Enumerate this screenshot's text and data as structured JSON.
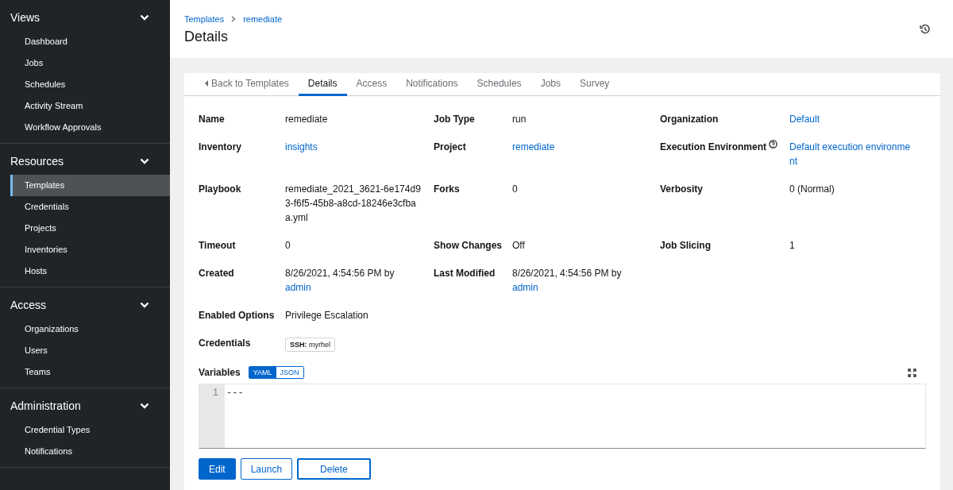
{
  "sidebar": {
    "sections": [
      {
        "title": "Views",
        "expanded": true,
        "items": [
          {
            "label": "Dashboard",
            "selected": false
          },
          {
            "label": "Jobs",
            "selected": false
          },
          {
            "label": "Schedules",
            "selected": false
          },
          {
            "label": "Activity Stream",
            "selected": false
          },
          {
            "label": "Workflow Approvals",
            "selected": false
          }
        ]
      },
      {
        "title": "Resources",
        "expanded": true,
        "items": [
          {
            "label": "Templates",
            "selected": true
          },
          {
            "label": "Credentials",
            "selected": false
          },
          {
            "label": "Projects",
            "selected": false
          },
          {
            "label": "Inventories",
            "selected": false
          },
          {
            "label": "Hosts",
            "selected": false
          }
        ]
      },
      {
        "title": "Access",
        "expanded": true,
        "items": [
          {
            "label": "Organizations",
            "selected": false
          },
          {
            "label": "Users",
            "selected": false
          },
          {
            "label": "Teams",
            "selected": false
          }
        ]
      },
      {
        "title": "Administration",
        "expanded": true,
        "items": [
          {
            "label": "Credential Types",
            "selected": false
          },
          {
            "label": "Notifications",
            "selected": false
          }
        ]
      }
    ]
  },
  "breadcrumb": [
    "Templates",
    "remediate"
  ],
  "title": "Details",
  "tabs": [
    {
      "label": "Back to Templates",
      "kind": "back",
      "selected": false
    },
    {
      "label": "Details",
      "kind": "tab",
      "selected": true
    },
    {
      "label": "Access",
      "kind": "tab",
      "selected": false
    },
    {
      "label": "Notifications",
      "kind": "tab",
      "selected": false
    },
    {
      "label": "Schedules",
      "kind": "tab",
      "selected": false
    },
    {
      "label": "Jobs",
      "kind": "tab",
      "selected": false
    },
    {
      "label": "Survey",
      "kind": "tab",
      "selected": false
    }
  ],
  "details": [
    [
      {
        "label": "Name",
        "kind": "text",
        "value": "remediate"
      },
      {
        "label": "Job Type",
        "kind": "text",
        "value": "run"
      },
      {
        "label": "Organization",
        "kind": "link",
        "value": "Default"
      }
    ],
    [
      {
        "label": "Inventory",
        "kind": "link",
        "value": "insights"
      },
      {
        "label": "Project",
        "kind": "link",
        "value": "remediate"
      },
      {
        "label": "Execution Environment",
        "help": true,
        "kind": "link",
        "value": "Default execution environment"
      }
    ],
    [
      {
        "label": "Playbook",
        "kind": "text",
        "value": "remediate_2021_3621-6e174d93-f6f5-45b8-a8cd-18246e3cfbaa.yml"
      },
      {
        "label": "Forks",
        "kind": "text",
        "value": "0"
      },
      {
        "label": "Verbosity",
        "kind": "text",
        "value": "0 (Normal)"
      }
    ],
    [
      {
        "label": "Timeout",
        "kind": "text",
        "value": "0"
      },
      {
        "label": "Show Changes",
        "kind": "text",
        "value": "Off"
      },
      {
        "label": "Job Slicing",
        "kind": "text",
        "value": "1"
      }
    ],
    [
      {
        "label": "Created",
        "kind": "by",
        "value": "8/26/2021, 4:54:56 PM by",
        "link": "admin"
      },
      {
        "label": "Last Modified",
        "kind": "by",
        "value": "8/26/2021, 4:54:56 PM by",
        "link": "admin"
      }
    ],
    [
      {
        "label": "Enabled Options",
        "kind": "text",
        "value": "Privilege Escalation"
      }
    ],
    [
      {
        "label": "Credentials",
        "kind": "chip",
        "value": "**SSH:** myrhel"
      }
    ]
  ],
  "variables": {
    "label": "Variables",
    "modes": [
      {
        "label": "YAML",
        "selected": true
      },
      {
        "label": "JSON",
        "selected": false
      }
    ],
    "lines": [
      {
        "number": "1",
        "text": "---"
      }
    ]
  },
  "buttons": [
    {
      "label": "Edit",
      "kind": "primary"
    },
    {
      "label": "Launch",
      "kind": "secondary"
    },
    {
      "label": "Delete",
      "kind": "danger"
    }
  ]
}
